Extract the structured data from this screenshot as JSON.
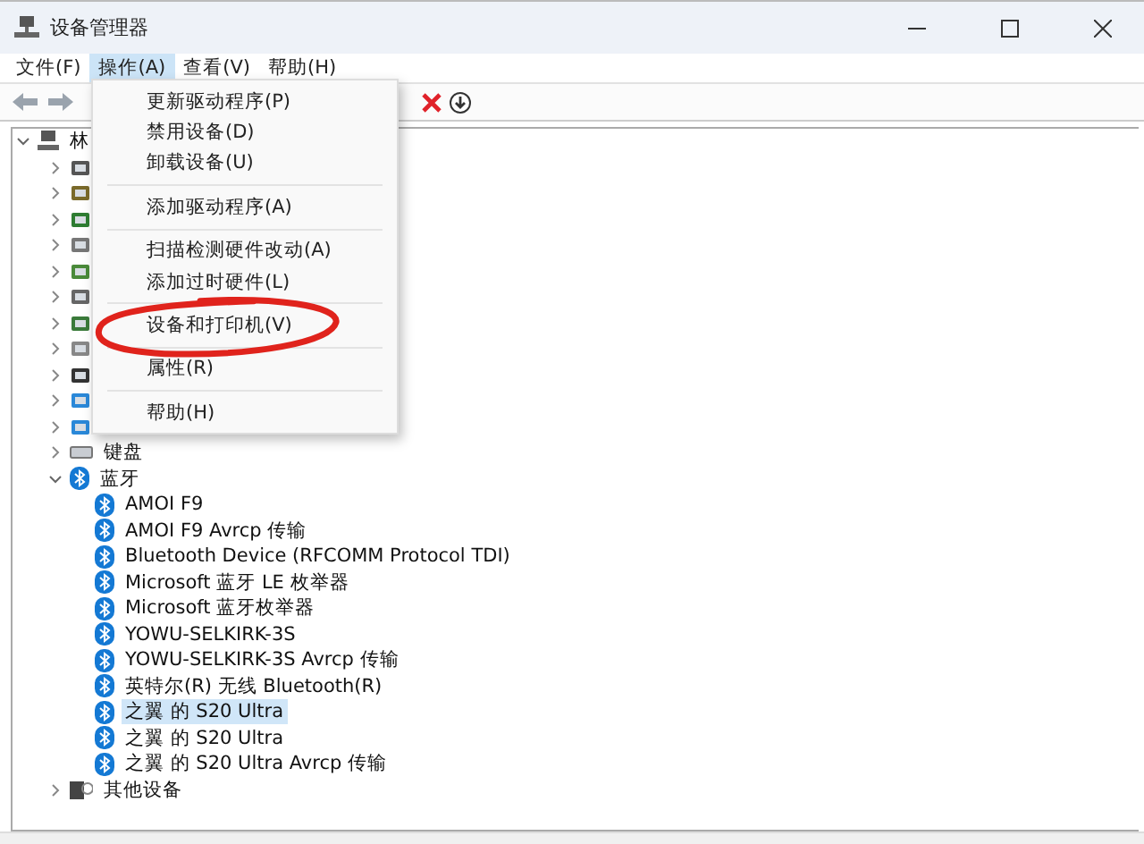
{
  "window": {
    "title": "设备管理器"
  },
  "menu_bar": [
    {
      "label": "文件(F)",
      "selected": false
    },
    {
      "label": "操作(A)",
      "selected": true
    },
    {
      "label": "查看(V)",
      "selected": false
    },
    {
      "label": "帮助(H)",
      "selected": false
    }
  ],
  "action_menu": {
    "items": [
      {
        "kind": "item",
        "label": "更新驱动程序(P)"
      },
      {
        "kind": "item",
        "label": "禁用设备(D)"
      },
      {
        "kind": "item",
        "label": "卸载设备(U)"
      },
      {
        "kind": "separator"
      },
      {
        "kind": "item",
        "label": "添加驱动程序(A)"
      },
      {
        "kind": "separator"
      },
      {
        "kind": "item",
        "label": "扫描检测硬件改动(A)"
      },
      {
        "kind": "item",
        "label": "添加过时硬件(L)"
      },
      {
        "kind": "separator"
      },
      {
        "kind": "item",
        "label": "设备和打印机(V)"
      },
      {
        "kind": "separator"
      },
      {
        "kind": "item",
        "label": "属性(R)"
      },
      {
        "kind": "separator"
      },
      {
        "kind": "item",
        "label": "帮助(H)"
      }
    ]
  },
  "tree": {
    "root": {
      "label": "林",
      "expanded": true,
      "children": [
        {
          "expanded": false
        },
        {
          "expanded": false
        },
        {
          "expanded": false
        },
        {
          "expanded": false
        },
        {
          "expanded": false
        },
        {
          "expanded": false
        },
        {
          "expanded": false
        },
        {
          "expanded": false
        },
        {
          "expanded": false
        },
        {
          "expanded": false
        },
        {
          "expanded": false
        },
        {
          "label": "键盘",
          "expanded": false
        },
        {
          "label": "蓝牙",
          "expanded": true,
          "children": [
            {
              "label": "AMOI F9",
              "selected": false
            },
            {
              "label": "AMOI F9 Avrcp 传输",
              "selected": false
            },
            {
              "label": "Bluetooth Device (RFCOMM Protocol TDI)",
              "selected": false
            },
            {
              "label": "Microsoft 蓝牙 LE 枚举器",
              "selected": false
            },
            {
              "label": "Microsoft 蓝牙枚举器",
              "selected": false
            },
            {
              "label": "YOWU-SELKIRK-3S",
              "selected": false
            },
            {
              "label": "YOWU-SELKIRK-3S Avrcp 传输",
              "selected": false
            },
            {
              "label": "英特尔(R) 无线 Bluetooth(R)",
              "selected": false
            },
            {
              "label": "之翼 的 S20 Ultra",
              "selected": true
            },
            {
              "label": "之翼 的 S20 Ultra",
              "selected": false
            },
            {
              "label": "之翼 的 S20 Ultra Avrcp 传输",
              "selected": false
            }
          ]
        },
        {
          "label": "其他设备",
          "expanded": false
        }
      ]
    }
  }
}
